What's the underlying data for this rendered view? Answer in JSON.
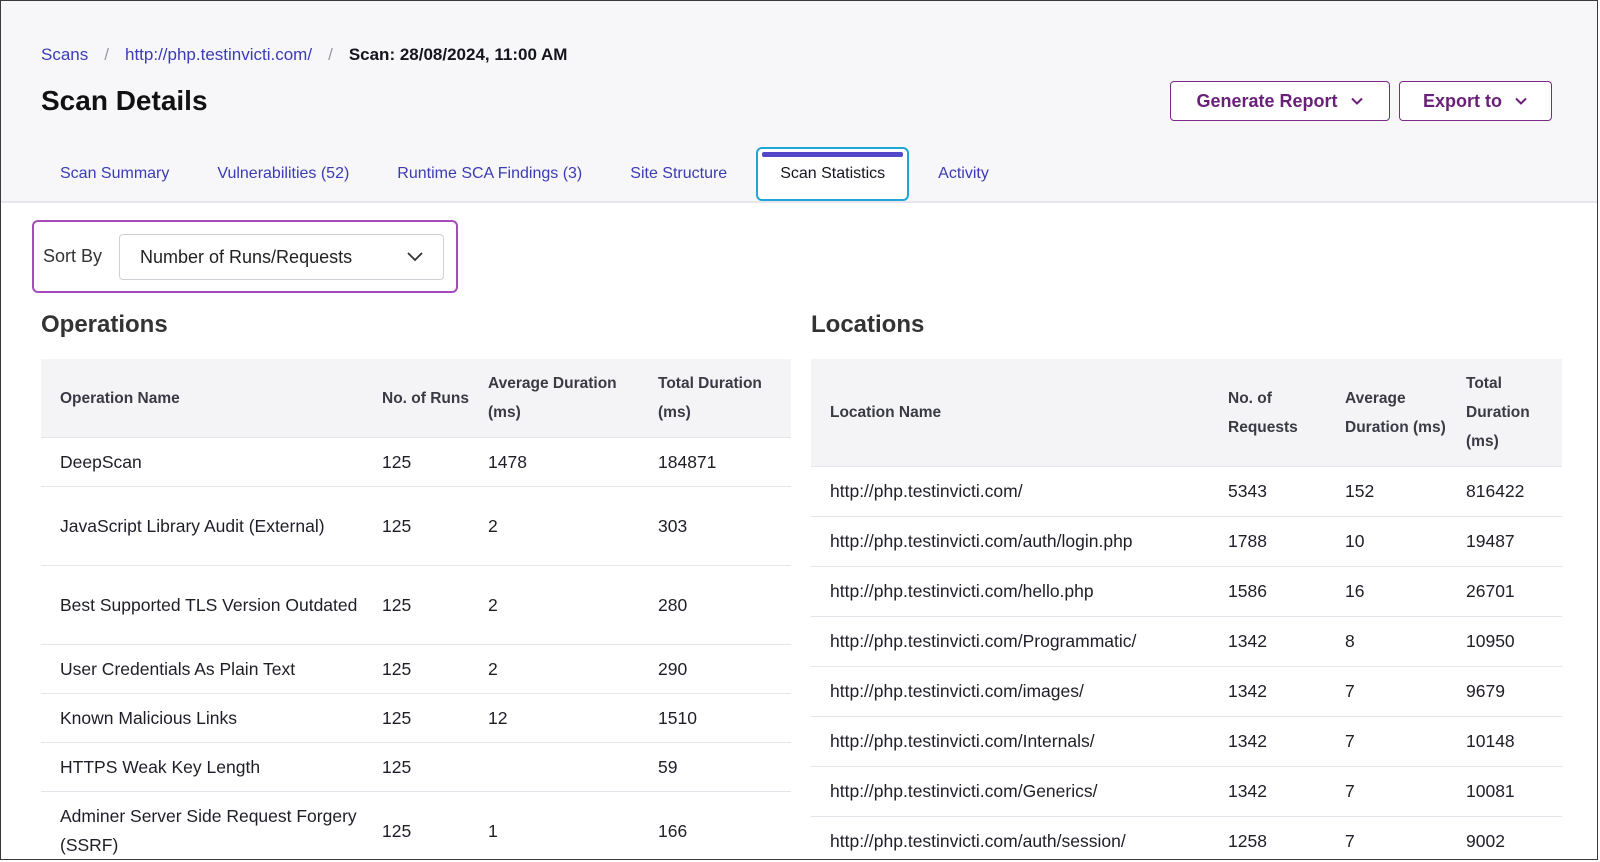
{
  "breadcrumb": {
    "items": [
      "Scans",
      "http://php.testinvicti.com/"
    ],
    "separator": "/",
    "current": "Scan: 28/08/2024, 11:00 AM"
  },
  "page": {
    "title": "Scan Details"
  },
  "actions": {
    "generate_report": "Generate Report",
    "export_to": "Export to"
  },
  "tabs": [
    {
      "label": "Scan Summary",
      "active": false
    },
    {
      "label": "Vulnerabilities (52)",
      "active": false
    },
    {
      "label": "Runtime SCA Findings (3)",
      "active": false
    },
    {
      "label": "Site Structure",
      "active": false
    },
    {
      "label": "Scan Statistics",
      "active": true
    },
    {
      "label": "Activity",
      "active": false
    }
  ],
  "sort": {
    "label": "Sort By",
    "selected": "Number of Runs/Requests"
  },
  "operations": {
    "title": "Operations",
    "columns": [
      "Operation Name",
      "No. of Runs",
      "Average Duration (ms)",
      "Total Duration (ms)"
    ],
    "rows": [
      [
        "DeepScan",
        "125",
        "1478",
        "184871"
      ],
      [
        "JavaScript Library Audit (External)",
        "125",
        "2",
        "303"
      ],
      [
        "Best Supported TLS Version Outdated",
        "125",
        "2",
        "280"
      ],
      [
        "User Credentials As Plain Text",
        "125",
        "2",
        "290"
      ],
      [
        "Known Malicious Links",
        "125",
        "12",
        "1510"
      ],
      [
        "HTTPS Weak Key Length",
        "125",
        "",
        "59"
      ],
      [
        "Adminer Server Side Request Forgery (SSRF)",
        "125",
        "1",
        "166"
      ]
    ]
  },
  "locations": {
    "title": "Locations",
    "columns": [
      "Location Name",
      "No. of Requests",
      "Average Duration (ms)",
      "Total Duration (ms)"
    ],
    "rows": [
      [
        "http://php.testinvicti.com/",
        "5343",
        "152",
        "816422"
      ],
      [
        "http://php.testinvicti.com/auth/login.php",
        "1788",
        "10",
        "19487"
      ],
      [
        "http://php.testinvicti.com/hello.php",
        "1586",
        "16",
        "26701"
      ],
      [
        "http://php.testinvicti.com/Programmatic/",
        "1342",
        "8",
        "10950"
      ],
      [
        "http://php.testinvicti.com/images/",
        "1342",
        "7",
        "9679"
      ],
      [
        "http://php.testinvicti.com/Internals/",
        "1342",
        "7",
        "10148"
      ],
      [
        "http://php.testinvicti.com/Generics/",
        "1342",
        "7",
        "10081"
      ],
      [
        "http://php.testinvicti.com/auth/session/",
        "1258",
        "7",
        "9002"
      ]
    ]
  },
  "colors": {
    "link": "#3b3bb5",
    "brand_button": "#7a2c86",
    "active_tab_outline": "#20a5d8",
    "active_tab_bar": "#5147c7",
    "sort_highlight": "#a64bbc"
  }
}
